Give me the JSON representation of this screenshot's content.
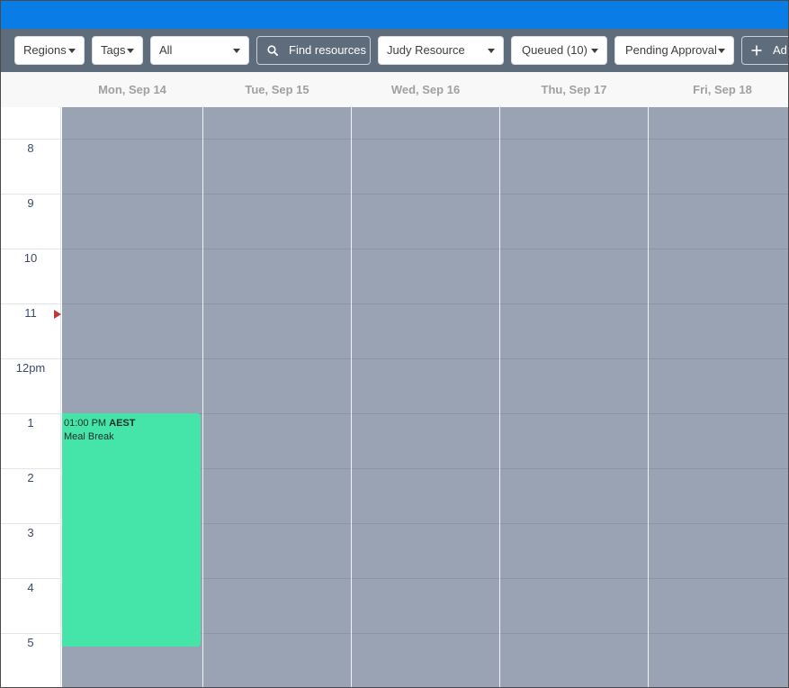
{
  "toolbar": {
    "regions": "Regions",
    "tags": "Tags",
    "all": "All",
    "find": "Find resources",
    "resource": "Judy Resource",
    "queued": "Queued (10)",
    "pending": "Pending Approval",
    "add": "Ad"
  },
  "days": [
    "Mon, Sep 14",
    "Tue, Sep 15",
    "Wed, Sep 16",
    "Thu, Sep 17",
    "Fri, Sep 18"
  ],
  "hours": [
    "8",
    "9",
    "10",
    "11",
    "12pm",
    "1",
    "2",
    "3",
    "4",
    "5"
  ],
  "event": {
    "time": "01:00 PM",
    "tz": "AEST",
    "title": "Meal Break"
  },
  "colors": {
    "topbar": "#0a7ce6",
    "toolbar": "#5f6c7b",
    "grid": "#9aa3b3",
    "event": "#45e5aa",
    "now_marker": "#c23934"
  }
}
